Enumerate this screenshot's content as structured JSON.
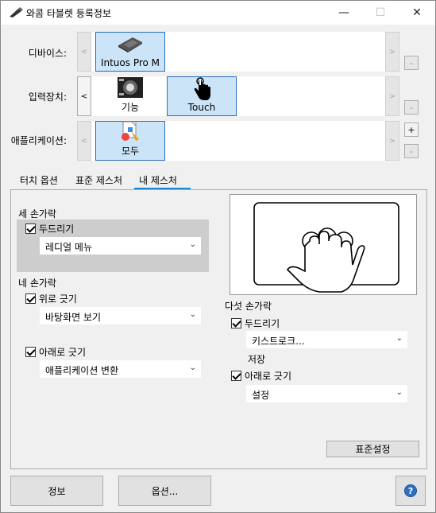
{
  "window": {
    "title": "와콤 타블렛 등록정보",
    "minimize": "—",
    "maximize": "☐",
    "close": "✕"
  },
  "rows": {
    "device": {
      "label": "디바이스:",
      "left_arrow": "<",
      "right_arrow": ">",
      "tiles": [
        {
          "label": "Intuos Pro M",
          "icon": "tablet-icon",
          "selected": true
        }
      ],
      "side_buttons": [
        "-"
      ]
    },
    "input": {
      "label": "입력장치:",
      "left_arrow": "<",
      "right_arrow": ">",
      "tiles": [
        {
          "label": "기능",
          "icon": "express-keys-icon",
          "selected": false
        },
        {
          "label": "Touch",
          "icon": "touch-hand-icon",
          "selected": true
        }
      ],
      "side_buttons": [
        "-"
      ]
    },
    "app": {
      "label": "애플리케이션:",
      "left_arrow": "<",
      "right_arrow": ">",
      "tiles": [
        {
          "label": "모두",
          "icon": "all-apps-icon",
          "selected": true
        }
      ],
      "side_buttons": [
        "+",
        "-"
      ]
    }
  },
  "tabs": [
    {
      "label": "터치 옵션",
      "active": false
    },
    {
      "label": "표준 제스처",
      "active": false
    },
    {
      "label": "내 제스처",
      "active": true
    }
  ],
  "three_finger": {
    "label": "세 손가락",
    "drag": {
      "label": "두드리기",
      "checked": true,
      "value": "레디얼 메뉴"
    }
  },
  "four_finger": {
    "label": "네 손가락",
    "swipe_up": {
      "label": "위로 긋기",
      "checked": true,
      "value": "바탕화면 보기"
    },
    "swipe_down": {
      "label": "아래로 긋기",
      "checked": true,
      "value": "애플리케이션 변환"
    }
  },
  "five_finger": {
    "label": "다섯 손가락",
    "tap": {
      "label": "두드리기",
      "checked": true,
      "value": "키스트로크...",
      "note": "저장"
    },
    "swipe_down": {
      "label": "아래로 긋기",
      "checked": true,
      "value": "설정"
    }
  },
  "caret": "⌄",
  "buttons": {
    "defaults": "표준설정",
    "about": "정보",
    "options": "옵션...",
    "help": "?"
  }
}
